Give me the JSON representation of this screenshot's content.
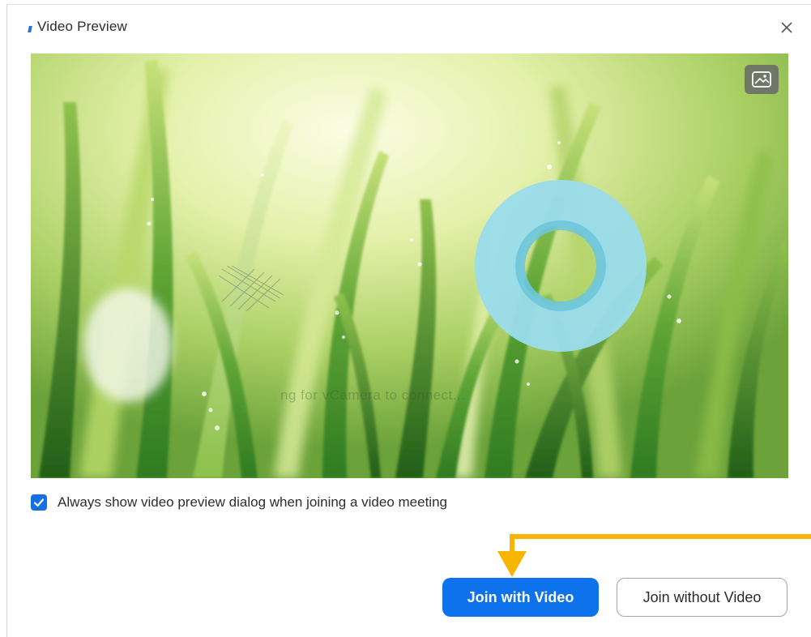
{
  "dialog": {
    "title": "Video Preview",
    "close_icon": "close-icon"
  },
  "preview": {
    "background_toggle_icon": "image-background-icon",
    "status_text": "ng for vCamera to connect...",
    "loading_icon": "loading-spinner-icon"
  },
  "options": {
    "always_show_label": "Always show video preview dialog when joining a video meeting",
    "always_show_checked": true
  },
  "actions": {
    "join_with_video": "Join with Video",
    "join_without_video": "Join without Video"
  },
  "colors": {
    "primary": "#0e72ed",
    "checkbox": "#1570e5",
    "annotation": "#f7b500",
    "spinner": "#9adcec"
  }
}
